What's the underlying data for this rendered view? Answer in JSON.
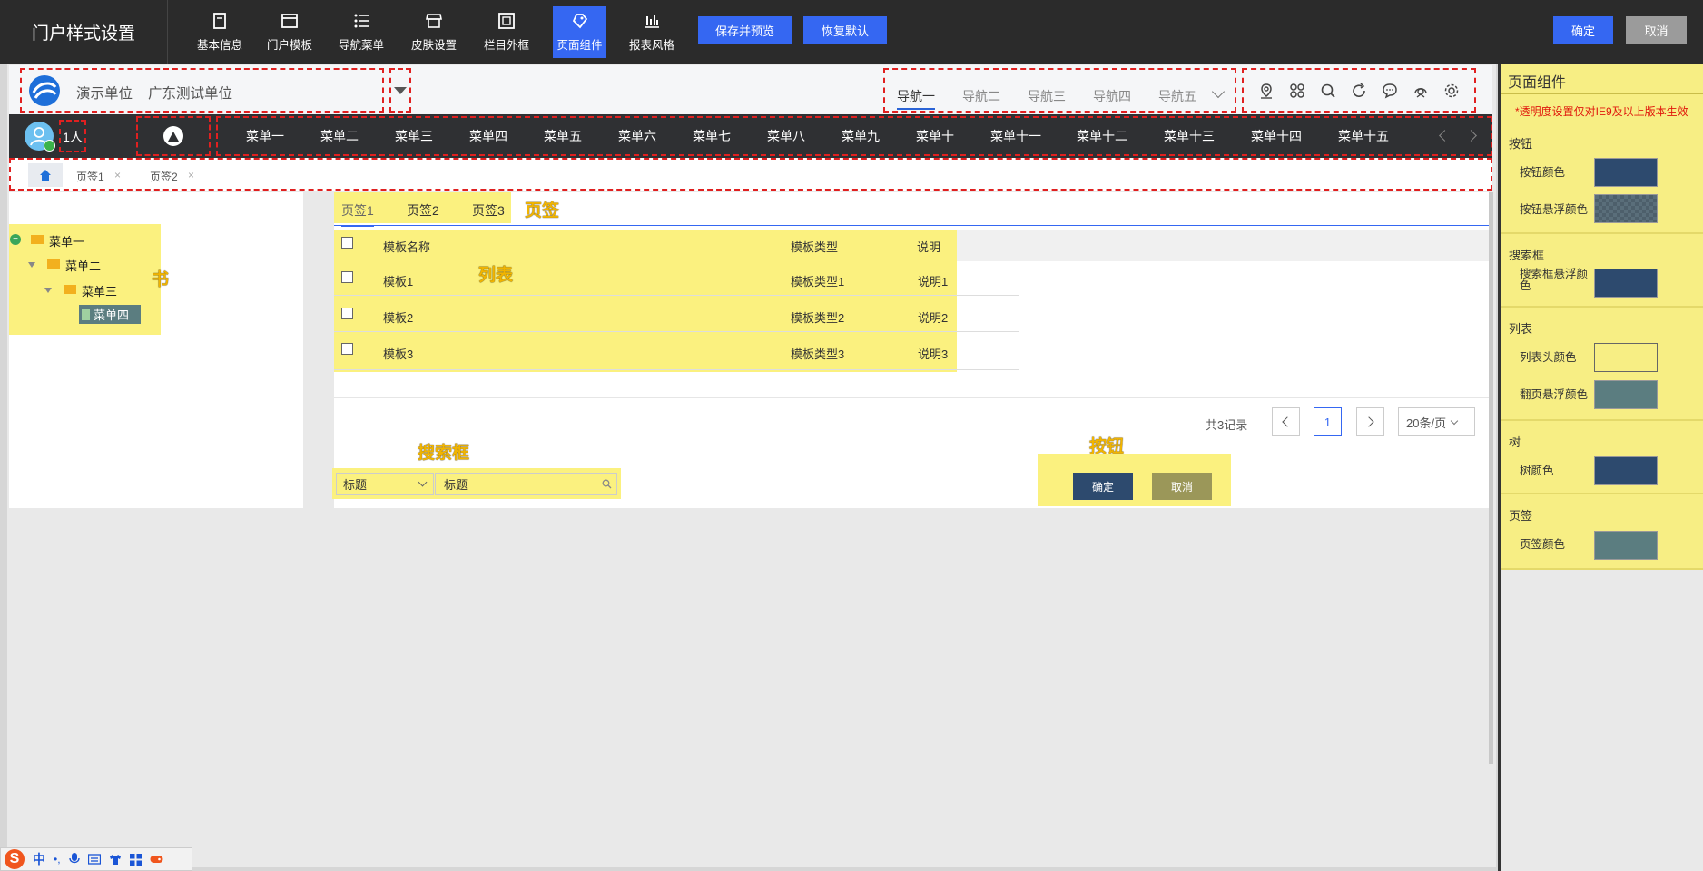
{
  "header": {
    "title": "门户样式设置",
    "tabs": [
      {
        "label": "基本信息",
        "icon": "book-icon"
      },
      {
        "label": "门户模板",
        "icon": "window-icon"
      },
      {
        "label": "导航菜单",
        "icon": "list-icon"
      },
      {
        "label": "皮肤设置",
        "icon": "store-icon"
      },
      {
        "label": "栏目外框",
        "icon": "frame-icon"
      },
      {
        "label": "页面组件",
        "icon": "puzzle-icon"
      },
      {
        "label": "报表风格",
        "icon": "bar-chart-icon"
      }
    ],
    "active_tab": "页面组件",
    "save_preview_label": "保存并预览",
    "restore_default_label": "恢复默认",
    "ok_label": "确定",
    "cancel_label": "取消"
  },
  "preview": {
    "unit_name": "演示单位",
    "unit_sub": "广东测试单位",
    "navs": [
      "导航一",
      "导航二",
      "导航三",
      "导航四",
      "导航五"
    ],
    "user_count": "1人",
    "menus": [
      "菜单一",
      "菜单二",
      "菜单三",
      "菜单四",
      "菜单五",
      "菜单六",
      "菜单七",
      "菜单八",
      "菜单九",
      "菜单十",
      "菜单十一",
      "菜单十二",
      "菜单十三",
      "菜单十四",
      "菜单十五"
    ],
    "page_tabs": [
      "页签1",
      "页签2"
    ],
    "tree": [
      "菜单一",
      "菜单二",
      "菜单三",
      "菜单四"
    ],
    "tree_label": "书",
    "inner_tabs": [
      "页签1",
      "页签2",
      "页签3"
    ],
    "inner_tabs_label": "页签",
    "list_label": "列表",
    "table": {
      "headers": [
        "模板名称",
        "模板类型",
        "说明"
      ],
      "rows": [
        [
          "模板1",
          "模板类型1",
          "说明1"
        ],
        [
          "模板2",
          "模板类型2",
          "说明2"
        ],
        [
          "模板3",
          "模板类型3",
          "说明3"
        ]
      ]
    },
    "pager": {
      "total": "共3记录",
      "page": "1",
      "page_size": "20条/页"
    },
    "search_label": "搜索框",
    "search": {
      "select_value": "标题",
      "input_value": "标题"
    },
    "button_label": "按钮",
    "ok": "确定",
    "cancel": "取消"
  },
  "panel": {
    "title": "页面组件",
    "note": "*透明度设置仅对IE9及以上版本生效",
    "sections": [
      {
        "title": "按钮",
        "items": [
          {
            "label": "按钮颜色",
            "color": "#2d4a6e"
          },
          {
            "label": "按钮悬浮颜色",
            "color": "#5a6e7a"
          }
        ]
      },
      {
        "title": "搜索框",
        "items": [
          {
            "label": "搜索框悬浮颜色",
            "color": "#2d4a6e"
          }
        ]
      },
      {
        "title": "列表",
        "items": [
          {
            "label": "列表头颜色",
            "color": "#f7ee84"
          },
          {
            "label": "翻页悬浮颜色",
            "color": "#5b7d80"
          }
        ]
      },
      {
        "title": "树",
        "items": [
          {
            "label": "树颜色",
            "color": "#2d4a6e"
          }
        ]
      },
      {
        "title": "页签",
        "items": [
          {
            "label": "页签颜色",
            "color": "#5b7d80"
          }
        ]
      }
    ]
  },
  "ime": {
    "lang": "中",
    "punct": "•,"
  }
}
